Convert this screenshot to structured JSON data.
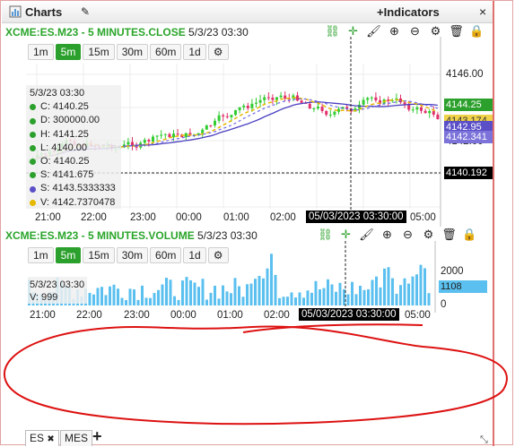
{
  "window": {
    "title": "Charts",
    "indicators_label": "+Indicators",
    "close_glyph": "×"
  },
  "price_chart": {
    "header_symbol": "XCME:ES.M23 - 5 MINUTES.CLOSE",
    "header_datetime": "5/3/23 03:30",
    "legend": {
      "date": "5/3/23 03:30",
      "items": [
        {
          "text": "C: 4140.25",
          "color": "#2ca02c"
        },
        {
          "text": "D: 300000.00",
          "color": "#2ca02c"
        },
        {
          "text": "H: 4141.25",
          "color": "#2ca02c"
        },
        {
          "text": "L: 4140.00",
          "color": "#2ca02c"
        },
        {
          "text": "O: 4140.25",
          "color": "#2ca02c"
        },
        {
          "text": "S: 4141.675",
          "color": "#2ca02c"
        },
        {
          "text": "S: 4143.5333333",
          "color": "#5b4fc7"
        },
        {
          "text": "V: 4142.7370478",
          "color": "#e6b800"
        }
      ]
    },
    "y_ticks": [
      "4146.00",
      "4144.00",
      "4142.00",
      "4140.00"
    ],
    "price_tags": [
      {
        "text": "4144.25",
        "bg": "#2ca02c",
        "fg": "#ffffff"
      },
      {
        "text": "4143.174",
        "bg": "#f0d24a",
        "fg": "#333333"
      },
      {
        "text": "4142.95",
        "bg": "#5b4fc7",
        "fg": "#ffffff"
      },
      {
        "text": "4142.341",
        "bg": "#7b73d9",
        "fg": "#ffffff"
      },
      {
        "text": "4140.192",
        "bg": "#000000",
        "fg": "#ffffff"
      }
    ],
    "x_ticks": [
      "21:00",
      "22:00",
      "23:00",
      "00:00",
      "01:00",
      "02:00",
      "05:00"
    ],
    "crosshair_label": "05/03/2023 03:30:00"
  },
  "timeframes": [
    "1m",
    "5m",
    "15m",
    "30m",
    "60m",
    "1d"
  ],
  "selected_timeframe": "5m",
  "volume_chart": {
    "header_symbol": "XCME:ES.M23 - 5 MINUTES.VOLUME",
    "header_datetime": "5/3/23 03:30",
    "legend_date": "5/3/23 03:30",
    "legend_value": "V: 999",
    "y_ticks": [
      "2000",
      "1000",
      "0"
    ],
    "last_value": "1108",
    "x_ticks": [
      "21:00",
      "22:00",
      "23:00",
      "00:00",
      "01:00",
      "02:00",
      "05:00"
    ],
    "crosshair_label": "05/03/2023 03:30:00"
  },
  "tabs": [
    {
      "label": "ES",
      "close": "✖"
    },
    {
      "label": "MES"
    }
  ],
  "add_tab_glyph": "+",
  "colors": {
    "up": "#33cc33",
    "down": "#e0306a",
    "sma_blue": "#4a3fc0",
    "dash_blue": "#6d65e6",
    "dash_yellow": "#e6b800",
    "volume": "#5bc0ef",
    "annotation": "#dd1111",
    "accent": "#2ca02c"
  }
}
